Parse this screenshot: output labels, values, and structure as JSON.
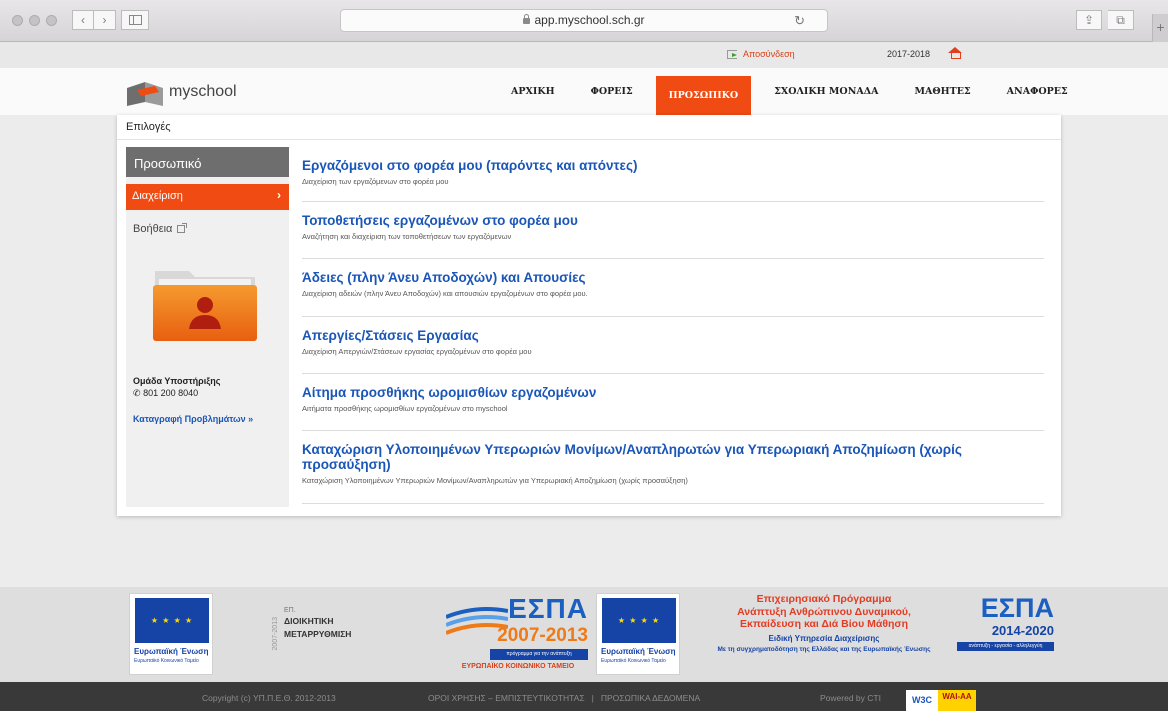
{
  "browser": {
    "url": "app.myschool.sch.gr",
    "reload_glyph": "↻",
    "back_glyph": "‹",
    "forward_glyph": "›",
    "share_glyph": "⇪",
    "tabs_glyph": "⧉",
    "new_tab_glyph": "+"
  },
  "topbar": {
    "logout": "Αποσύνδεση",
    "year": "2017-2018"
  },
  "logo": {
    "text": "myschool"
  },
  "nav": [
    {
      "label": "ΑΡΧΙΚΗ",
      "active": false
    },
    {
      "label": "ΦΟΡΕΙΣ",
      "active": false
    },
    {
      "label": "ΠΡΟΣΩΠΙΚΟ",
      "active": true
    },
    {
      "label": "ΣΧΟΛΙΚΗ ΜΟΝΑΔΑ",
      "active": false
    },
    {
      "label": "ΜΑΘΗΤΕΣ",
      "active": false
    },
    {
      "label": "ΑΝΑΦΟΡΕΣ",
      "active": false
    }
  ],
  "options_title": "Επιλογές",
  "sidebar": {
    "header": "Προσωπικό",
    "active_item": "Διαχείριση",
    "active_chevron": "›",
    "help_item": "Βοήθεια",
    "support": {
      "title": "Ομάδα Υποστήριξης",
      "phone": "801 200 8040",
      "phone_glyph": "✆",
      "report_link": "Καταγραφή Προβλημάτων »"
    }
  },
  "entries": [
    {
      "title": "Εργαζόμενοι στο φορέα μου (παρόντες και απόντες)",
      "desc": "Διαχείριση των εργαζόμενων στο φορέα μου"
    },
    {
      "title": "Τοποθετήσεις εργαζομένων στο φορέα μου",
      "desc": "Αναζήτηση και διαχείριση των τοποθετήσεων των εργαζόμενων"
    },
    {
      "title": "Άδειες (πλην Άνευ Αποδοχών) και Απουσίες",
      "desc": "Διαχείριση αδειών (πλην Άνευ Αποδοχών) και απουσιών εργαζομένων στο φορέα μου."
    },
    {
      "title": "Απεργίες/Στάσεις Εργασίας",
      "desc": "Διαχείριση Απεργιών/Στάσεων εργασίας εργαζομένων στο φορέα μου"
    },
    {
      "title": "Αίτημα προσθήκης ωρομισθίων εργαζομένων",
      "desc": "Αιτήματα προσθήκης ωρομισθίων εργαζομένων στο myschool"
    },
    {
      "title": "Καταχώριση Υλοποιημένων Υπερωριών Μονίμων/Αναπληρωτών για Υπερωριακή Αποζημίωση (χωρίς προσαύξηση)",
      "desc": "Καταχώριση Υλοποιημένων Υπερωριών Μονίμων/Αναπληρωτών για Υπερωριακή Αποζημίωση (χωρίς προσαύξηση)"
    }
  ],
  "footer_logos": {
    "eu1": {
      "label": "Ευρωπαϊκή Ένωση",
      "sub": "Ευρωπαϊκό Κοινωνικό Ταμείο"
    },
    "dm": {
      "ep": "ΕΠ.",
      "line1": "ΔΙΟΙΚΗΤΙΚΗ",
      "line2": "ΜΕΤΑΡΡΥΘΜΙΣΗ",
      "side": "2007-2013"
    },
    "espa1": {
      "word": "ΕΣΠΑ",
      "years": "2007-2013",
      "prog": "πρόγραμμα για την ανάπτυξη",
      "fund": "ΕΥΡΩΠΑΪΚΟ ΚΟΙΝΩΝΙΚΟ ΤΑΜΕΙΟ"
    },
    "eu2": {
      "label": "Ευρωπαϊκή Ένωση",
      "sub": "Ευρωπαϊκό Κοινωνικό Ταμείο"
    },
    "op": {
      "title1": "Επιχειρησιακό Πρόγραμμα",
      "title2": "Ανάπτυξη Ανθρώπινου Δυναμικού,",
      "title3": "Εκπαίδευση και Διά Βίου Μάθηση",
      "sub": "Ειδική Υπηρεσία Διαχείρισης",
      "cofund": "Με τη συγχρηματοδότηση της Ελλάδας και της Ευρωπαϊκής Ένωσης"
    },
    "espa2": {
      "word": "ΕΣΠΑ",
      "years": "2014-2020",
      "bar": "ανάπτυξη - εργασία - αλληλεγγύη"
    }
  },
  "footer": {
    "copyright": "Copyright (c) ΥΠ.Π.Ε.Θ. 2012-2013",
    "terms": "ΟΡΟΙ ΧΡΗΣΗΣ – ΕΜΠΙΣΤΕΥΤΙΚΟΤΗΤΑΣ",
    "separator": "|",
    "privacy": "ΠΡΟΣΩΠΙΚΑ ΔΕΔΟΜΕΝΑ",
    "powered": "Powered by CTI",
    "w3c": "W3C",
    "wai": "WAI-AA"
  },
  "colors": {
    "accent": "#ef4b13",
    "link": "#1a56b8",
    "footer_bg": "#393939"
  }
}
